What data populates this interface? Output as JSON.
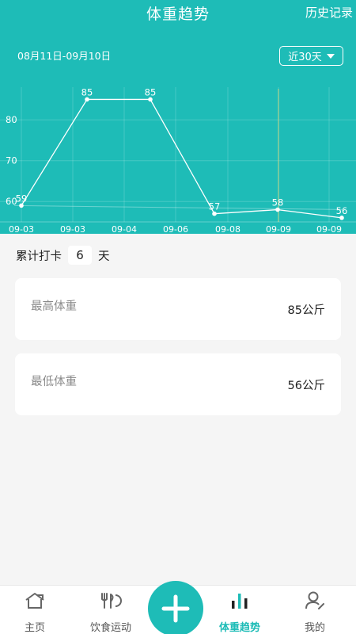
{
  "header": {
    "title": "体重趋势",
    "history_label": "历史记录"
  },
  "filter": {
    "date_range": "08月11日-09月10日",
    "range_select": "近30天"
  },
  "chart_data": {
    "type": "line",
    "x": [
      "09-03",
      "09-03",
      "09-04",
      "09-06",
      "09-08",
      "09-09",
      "09-09"
    ],
    "series": [
      {
        "values": [
          59,
          85,
          85,
          57,
          58,
          56
        ]
      }
    ],
    "point_labels": [
      "59",
      "85",
      "85",
      "57",
      "58",
      "56"
    ],
    "ytick_labels": [
      "80",
      "70",
      "60"
    ],
    "yticks": [
      80,
      70,
      60
    ],
    "ylim": [
      55,
      88
    ],
    "grid": true,
    "xlabel": "",
    "ylabel": ""
  },
  "checkin": {
    "prefix": "累计打卡",
    "days": "6",
    "suffix": "天"
  },
  "stats": {
    "max_label": "最高体重",
    "max_value": "85公斤",
    "min_label": "最低体重",
    "min_value": "56公斤"
  },
  "nav": {
    "home": "主页",
    "diet": "饮食运动",
    "trend": "体重趋势",
    "mine": "我的",
    "accent": "#1ebcb7"
  }
}
